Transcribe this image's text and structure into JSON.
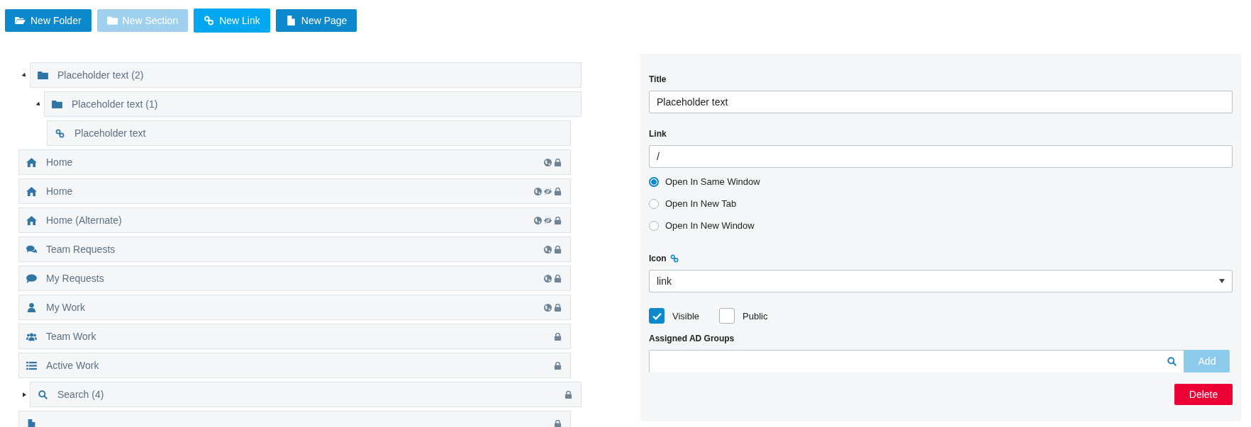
{
  "toolbar": [
    {
      "label": "New Folder",
      "kind": "folder-open",
      "disabled": false,
      "selected": false
    },
    {
      "label": "New Section",
      "kind": "folder",
      "disabled": true,
      "selected": false
    },
    {
      "label": "New Link",
      "kind": "link",
      "disabled": false,
      "selected": true
    },
    {
      "label": "New Page",
      "kind": "page",
      "disabled": false,
      "selected": false
    }
  ],
  "tree": [
    {
      "label": "Placeholder text (2)",
      "kind": "folder",
      "expanded": true,
      "public": false,
      "hidden": false,
      "locked": false,
      "children": [
        {
          "label": "Placeholder text (1)",
          "kind": "folder",
          "expanded": true,
          "public": false,
          "hidden": false,
          "locked": false,
          "children": [
            {
              "label": "Placeholder text",
              "kind": "link",
              "public": false,
              "hidden": false,
              "locked": false
            }
          ]
        }
      ]
    },
    {
      "label": "Home",
      "kind": "home",
      "public": true,
      "hidden": false,
      "locked": true
    },
    {
      "label": "Home",
      "kind": "home",
      "public": true,
      "hidden": true,
      "locked": true
    },
    {
      "label": "Home (Alternate)",
      "kind": "home",
      "public": true,
      "hidden": true,
      "locked": true
    },
    {
      "label": "Team Requests",
      "kind": "comments",
      "public": true,
      "hidden": false,
      "locked": true
    },
    {
      "label": "My Requests",
      "kind": "comment",
      "public": true,
      "hidden": false,
      "locked": true
    },
    {
      "label": "My Work",
      "kind": "user",
      "public": true,
      "hidden": false,
      "locked": true
    },
    {
      "label": "Team Work",
      "kind": "users",
      "public": false,
      "hidden": false,
      "locked": true
    },
    {
      "label": "Active Work",
      "kind": "list",
      "public": false,
      "hidden": false,
      "locked": true
    },
    {
      "label": "Search (4)",
      "kind": "search",
      "expanded": false,
      "public": false,
      "hidden": false,
      "locked": true
    },
    {
      "kind": "page",
      "public": false,
      "hidden": false,
      "locked": true
    }
  ],
  "form": {
    "title": {
      "label": "Title",
      "value": "Placeholder text"
    },
    "link": {
      "label": "Link",
      "value": "/"
    },
    "targets": [
      {
        "label": "Open In Same Window",
        "selected": true
      },
      {
        "label": "Open In New Tab",
        "selected": false
      },
      {
        "label": "Open In New Window",
        "selected": false
      }
    ],
    "icon": {
      "label": "Icon",
      "value": "link"
    },
    "checks": [
      {
        "label": "Visible",
        "checked": true
      },
      {
        "label": "Public",
        "checked": false
      }
    ],
    "groups": {
      "label": "Assigned AD Groups",
      "add": "Add",
      "add_disabled": true
    },
    "delete": "Delete"
  }
}
